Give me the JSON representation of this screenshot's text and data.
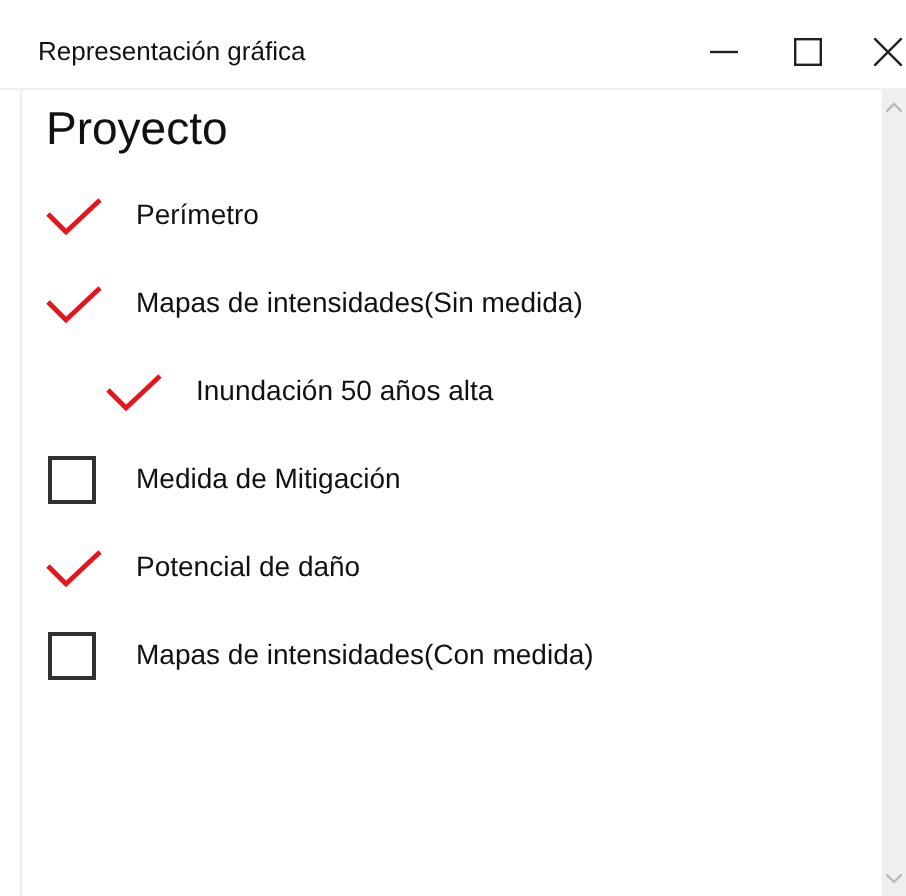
{
  "window": {
    "title": "Representación gráfica"
  },
  "heading": "Proyecto",
  "items": [
    {
      "label": "Perímetro",
      "checked": true
    },
    {
      "label": "Mapas de intensidades(Sin medida)",
      "checked": true,
      "children": [
        {
          "label": "Inundación 50 años alta",
          "checked": true
        }
      ]
    },
    {
      "label": "Medida de Mitigación",
      "checked": false
    },
    {
      "label": "Potencial de daño",
      "checked": true
    },
    {
      "label": "Mapas de intensidades(Con medida)",
      "checked": false
    }
  ]
}
